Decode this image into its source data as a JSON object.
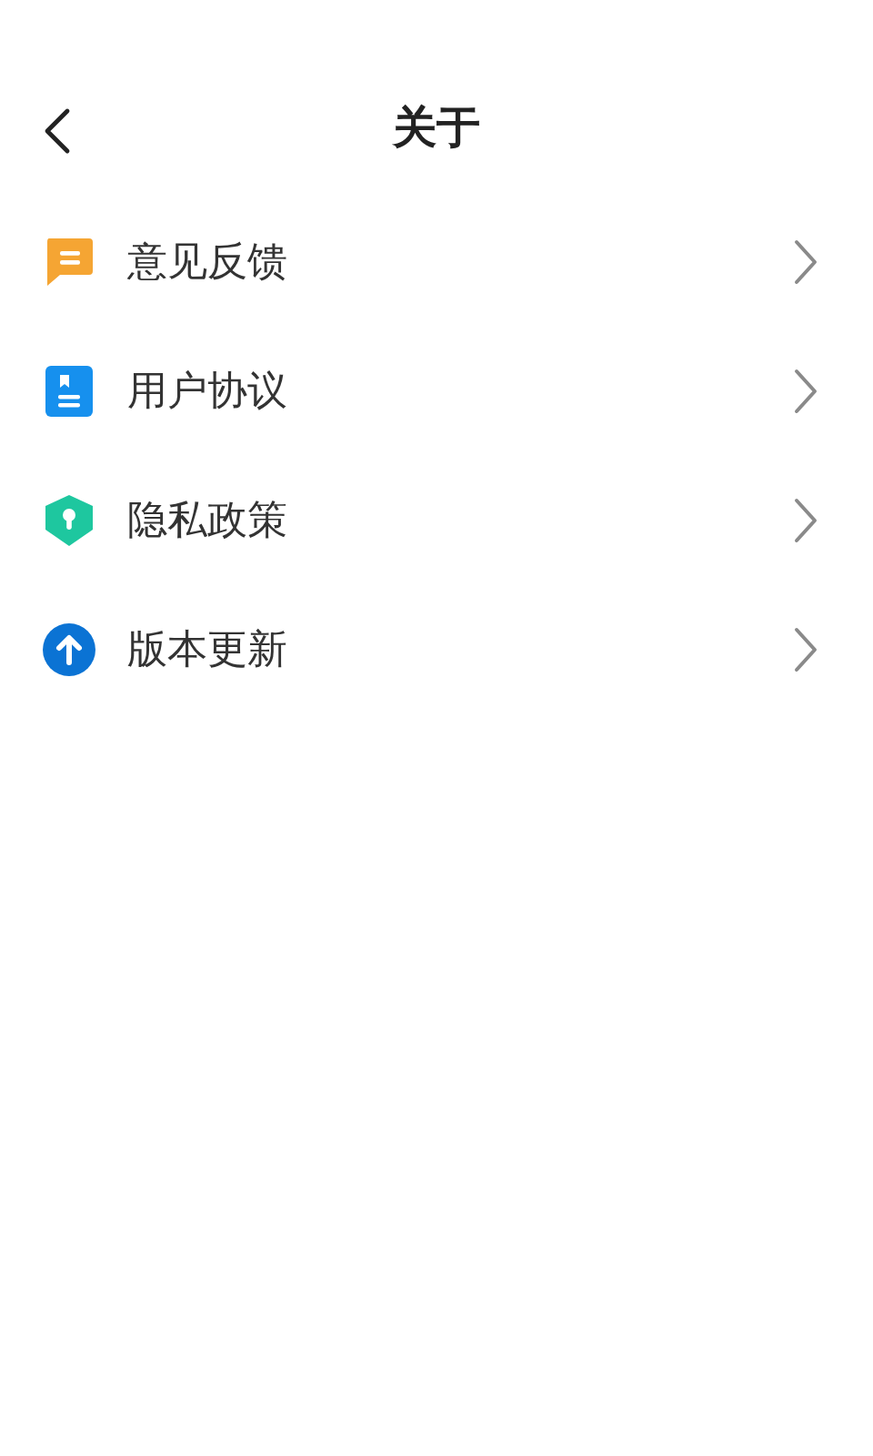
{
  "header": {
    "title": "关于"
  },
  "items": [
    {
      "kind": "feedback",
      "label": "意见反馈"
    },
    {
      "kind": "document",
      "label": "用户协议"
    },
    {
      "kind": "shield",
      "label": "隐私政策"
    },
    {
      "kind": "update",
      "label": "版本更新"
    }
  ]
}
